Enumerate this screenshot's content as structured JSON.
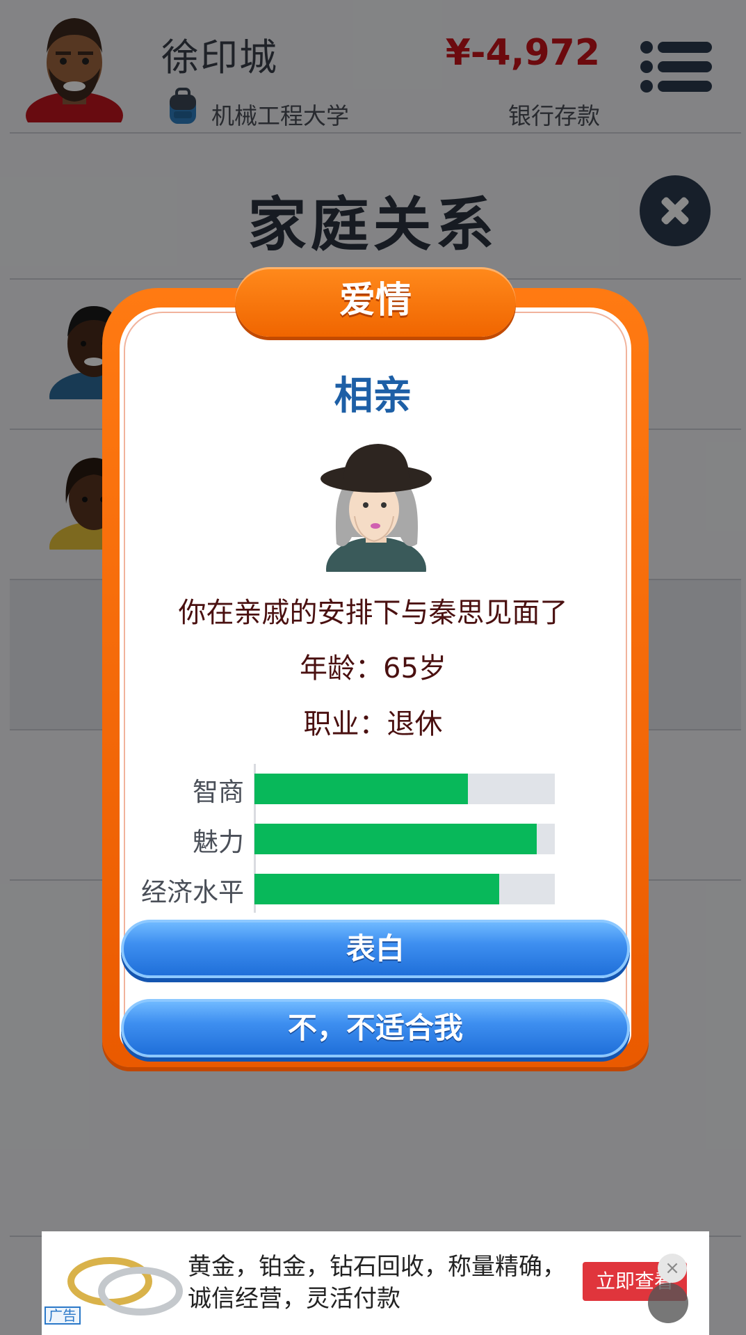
{
  "header": {
    "player_name": "徐印城",
    "school": "机械工程大学",
    "money": "¥-4,972",
    "money_label": "银行存款"
  },
  "page": {
    "title": "家庭关系"
  },
  "modal": {
    "category": "爱情",
    "event_title": "相亲",
    "description": "你在亲戚的安排下与秦思见面了",
    "age_line": "年龄：65岁",
    "job_line": "职业：退休",
    "stats": [
      {
        "label": "智商",
        "value": 0.71
      },
      {
        "label": "魅力",
        "value": 0.94
      },
      {
        "label": "经济水平",
        "value": 0.815
      }
    ],
    "confess_button": "表白",
    "decline_button": "不，不适合我"
  },
  "ad": {
    "text": "黄金，铂金，钻石回收，称量精确，诚信经营，灵活付款",
    "cta": "立即查看",
    "tag": "广告",
    "close": "×"
  },
  "colors": {
    "accent_orange": "#f06500",
    "money_red": "#c8141b",
    "button_blue": "#3e8ff0",
    "stat_green": "#08b85a",
    "title_blue": "#1d5fa6"
  },
  "icons": {
    "menu": "menu-icon",
    "close": "close-icon",
    "school": "backpack-icon"
  }
}
